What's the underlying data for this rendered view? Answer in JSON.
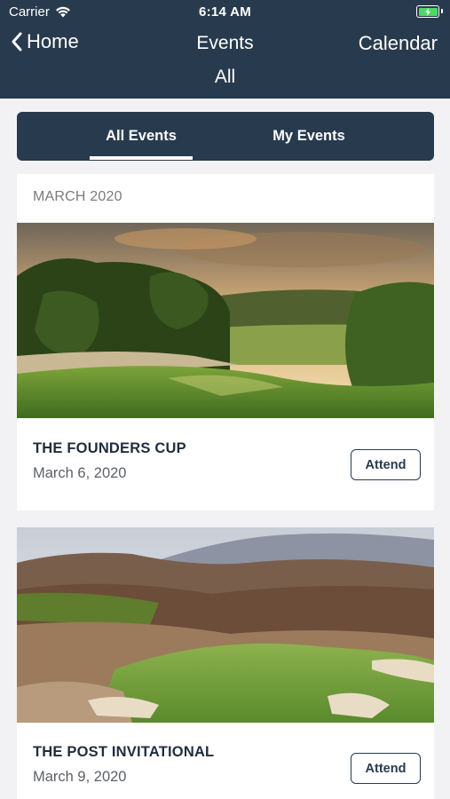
{
  "status_bar": {
    "carrier": "Carrier",
    "time": "6:14 AM",
    "wifi_icon": "wifi-icon",
    "battery_icon": "battery-charging-icon"
  },
  "nav": {
    "back_label": "Home",
    "back_icon": "chevron-left-icon",
    "title": "Events",
    "subtitle": "All",
    "right_label": "Calendar"
  },
  "tabs": [
    {
      "label": "All Events",
      "selected": true
    },
    {
      "label": "My Events",
      "selected": false
    }
  ],
  "month_header": "MARCH 2020",
  "events": [
    {
      "title": "THE FOUNDERS CUP",
      "date": "March 6, 2020",
      "button": "Attend"
    },
    {
      "title": "THE POST INVITATIONAL",
      "date": "March 9, 2020",
      "button": "Attend"
    }
  ],
  "colors": {
    "header_bg": "#283b4e",
    "page_bg": "#f2f2f4",
    "card_bg": "#ffffff",
    "battery_green": "#4cd964",
    "title_text": "#1f2e3c",
    "date_text": "#5e6166"
  }
}
